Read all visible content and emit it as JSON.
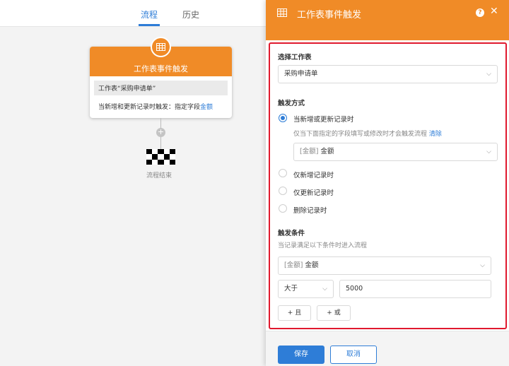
{
  "tabs": [
    {
      "label": "流程",
      "active": true
    },
    {
      "label": "历史",
      "active": false
    }
  ],
  "node": {
    "title": "工作表事件触发",
    "sheet_text": "工作表“采购申请单”",
    "trigger_text": "当新增和更新记录时触发：指定字段",
    "trigger_field": "金额"
  },
  "end_label": "流程结束",
  "panel": {
    "title": "工作表事件触发",
    "select_sheet": {
      "label": "选择工作表",
      "value": "采购申请单"
    },
    "trigger": {
      "label": "触发方式",
      "options": [
        {
          "label": "当新增或更新记录时",
          "selected": true
        },
        {
          "label": "仅新增记录时",
          "selected": false
        },
        {
          "label": "仅更新记录时",
          "selected": false
        },
        {
          "label": "删除记录时",
          "selected": false
        }
      ],
      "hint": "仅当下面指定的字段填写或修改时才会触发流程",
      "hint_link": "清除",
      "field_prefix": "[金额]",
      "field_value": "金额"
    },
    "condition": {
      "label": "触发条件",
      "hint": "当记录满足以下条件时进入流程",
      "field_prefix": "[金额]",
      "field_value": "金额",
      "operator": "大于",
      "value": "5000",
      "and_label": "+ 且",
      "or_label": "+ 或"
    },
    "save_label": "保存",
    "cancel_label": "取消"
  },
  "colors": {
    "accent": "#f08b27",
    "primary": "#2e7dd7",
    "highlight": "#e0192e"
  }
}
